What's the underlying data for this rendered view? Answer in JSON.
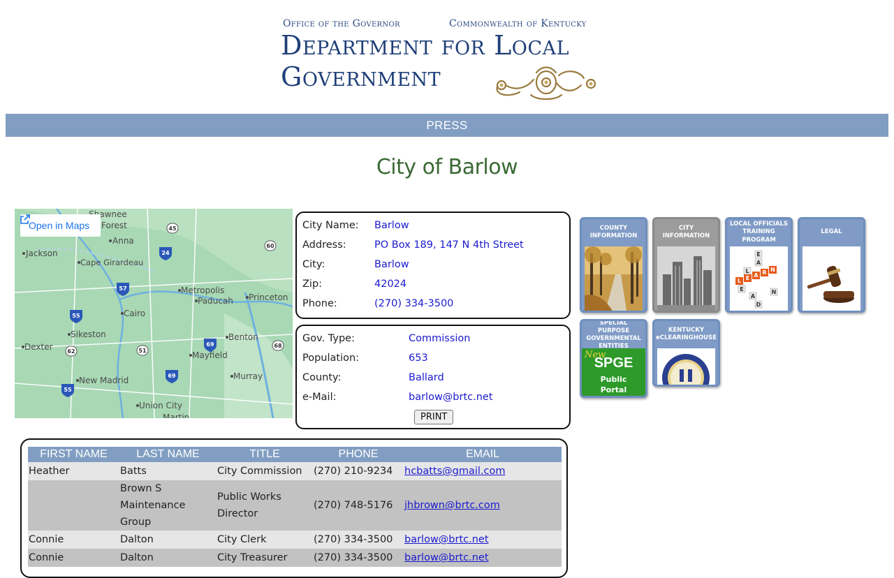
{
  "header": {
    "office": "Office of the Governor",
    "commonwealth": "Commonwealth of Kentucky",
    "dept_line1": "Department for Local",
    "dept_line2": "Government",
    "ornament_icon": "gold-scroll-ornament"
  },
  "nav": {
    "items": [
      {
        "label": "PRESS"
      }
    ]
  },
  "page_title": "City of Barlow",
  "map": {
    "open_in_maps": "Open in Maps",
    "places": [
      "Forest",
      "Jackson",
      "Anna",
      "Cape Girardeau",
      "Metropolis",
      "Paducah",
      "Princeton",
      "Cairo",
      "Sikeston",
      "Benton",
      "Dexter",
      "Mayfield",
      "New Madrid",
      "Murray",
      "Union City",
      "Shawnee",
      "Martin"
    ],
    "route_shields": [
      "45",
      "60",
      "24",
      "57",
      "55",
      "69",
      "62",
      "51",
      "68",
      "69",
      "55"
    ]
  },
  "city_info": {
    "rows": [
      {
        "label": "City Name:",
        "value": "Barlow"
      },
      {
        "label": "Address:",
        "value": "PO Box 189, 147 N 4th Street"
      },
      {
        "label": "City:",
        "value": "Barlow"
      },
      {
        "label": "Zip:",
        "value": "42024"
      },
      {
        "label": "Phone:",
        "value": "(270) 334-3500"
      }
    ]
  },
  "gov_info": {
    "rows": [
      {
        "label": "Gov. Type:",
        "value": "Commission"
      },
      {
        "label": "Population:",
        "value": "653"
      },
      {
        "label": "County:",
        "value": "Ballard"
      },
      {
        "label": "e-Mail:",
        "value": "barlow@brtc.net"
      }
    ],
    "print_label": "PRINT"
  },
  "tiles": [
    {
      "line1": "COUNTY",
      "line2": "INFORMATION",
      "line3": ""
    },
    {
      "line1": "CITY",
      "line2": "INFORMATION",
      "line3": ""
    },
    {
      "line1": "LOCAL OFFICIALS",
      "line2": "TRAINING",
      "line3": "PROGRAM"
    },
    {
      "line1": "LEGAL",
      "line2": "",
      "line3": ""
    },
    {
      "line1": "SPECIAL PURPOSE",
      "line2": "GOVERNMENTAL",
      "line3": "ENTITIES",
      "badge": "New",
      "title": "SPGE",
      "sub1": "Public",
      "sub2": "Portal"
    },
    {
      "line1": "KENTUCKY",
      "line2": "eCLEARINGHOUSE",
      "line3": ""
    }
  ],
  "officials": {
    "headers": [
      "FIRST NAME",
      "LAST NAME",
      "TITLE",
      "PHONE",
      "EMAIL"
    ],
    "rows": [
      {
        "first": "Heather",
        "last": "Batts",
        "title": "City Commission",
        "phone": "(270) 210-9234",
        "email": "hcbatts@gmail.com"
      },
      {
        "first": "",
        "last": "Brown S Maintenance Group",
        "title": "Public Works Director",
        "phone": "(270) 748-5176",
        "email": "jhbrown@brtc.com"
      },
      {
        "first": "Connie",
        "last": "Dalton",
        "title": "City Clerk",
        "phone": "(270) 334-3500",
        "email": "barlow@brtc.net"
      },
      {
        "first": "Connie",
        "last": "Dalton",
        "title": "City Treasurer",
        "phone": "(270) 334-3500",
        "email": "barlow@brtc.net"
      }
    ]
  }
}
